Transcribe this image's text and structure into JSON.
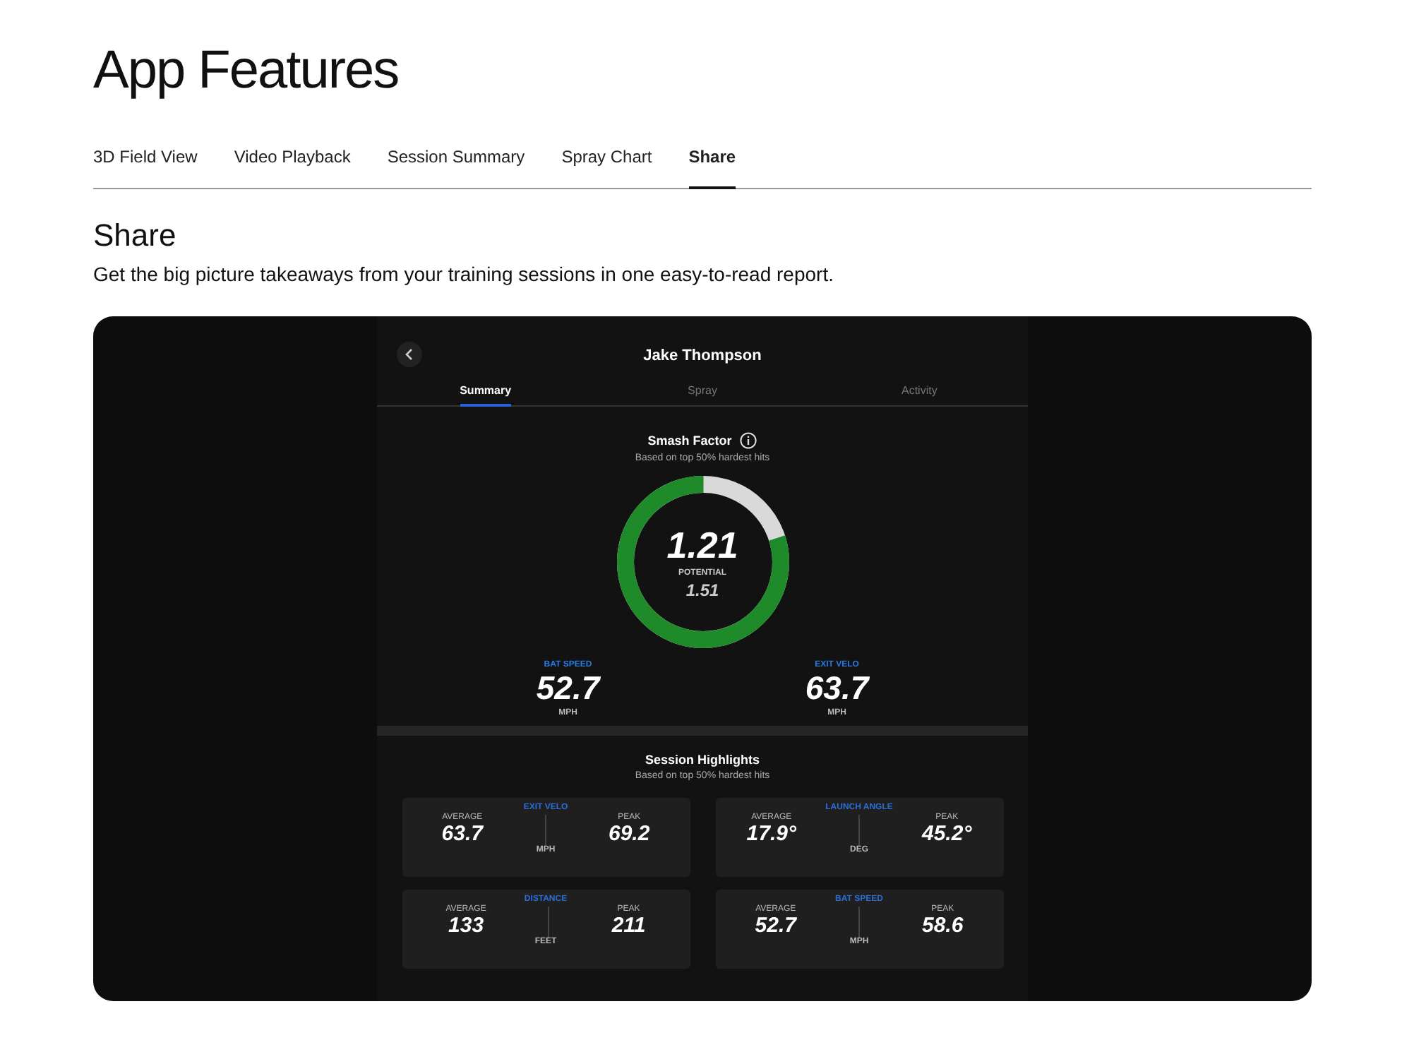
{
  "page_title": "App Features",
  "tabs": [
    {
      "label": "3D Field View",
      "selected": false
    },
    {
      "label": "Video Playback",
      "selected": false
    },
    {
      "label": "Session Summary",
      "selected": false
    },
    {
      "label": "Spray Chart",
      "selected": false
    },
    {
      "label": "Share",
      "selected": true
    }
  ],
  "section": {
    "heading": "Share",
    "description": "Get the big picture takeaways from your training sessions in one easy-to-read report."
  },
  "app": {
    "player_name": "Jake Thompson",
    "tabs": [
      {
        "label": "Summary",
        "selected": true
      },
      {
        "label": "Spray",
        "selected": false
      },
      {
        "label": "Activity",
        "selected": false
      }
    ],
    "smash_factor": {
      "title": "Smash Factor",
      "subtitle": "Based on top 50% hardest hits",
      "value": "1.21",
      "level": 0.8,
      "potential_label": "POTENTIAL",
      "potential": "1.51"
    },
    "stats": [
      {
        "label": "BAT SPEED",
        "value": "52.7",
        "unit": "MPH"
      },
      {
        "label": "EXIT VELO",
        "value": "63.7",
        "unit": "MPH"
      }
    ],
    "highlights": {
      "title": "Session Highlights",
      "subtitle": "Based on top 50% hardest hits",
      "cards": [
        {
          "title": "EXIT VELO",
          "average_label": "AVERAGE",
          "average": "63.7",
          "peak_label": "PEAK",
          "peak": "69.2",
          "unit": "MPH"
        },
        {
          "title": "LAUNCH ANGLE",
          "average_label": "AVERAGE",
          "average": "17.9°",
          "peak_label": "PEAK",
          "peak": "45.2°",
          "unit": "DEG"
        },
        {
          "title": "DISTANCE",
          "average_label": "AVERAGE",
          "average": "133",
          "peak_label": "PEAK",
          "peak": "211",
          "unit": "FEET"
        },
        {
          "title": "BAT SPEED",
          "average_label": "AVERAGE",
          "average": "52.7",
          "peak_label": "PEAK",
          "peak": "58.6",
          "unit": "MPH"
        }
      ]
    }
  }
}
